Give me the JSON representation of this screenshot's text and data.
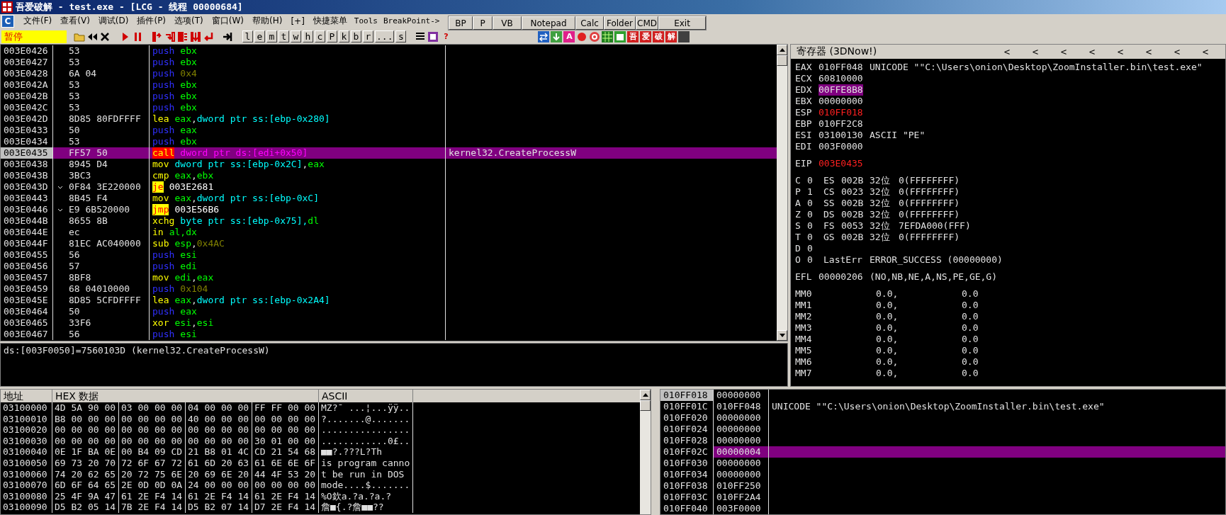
{
  "window": {
    "title": "吾爱破解 - test.exe - [LCG - 线程 00000684]"
  },
  "menu": {
    "system_button": "C",
    "items": [
      "文件(F)",
      "查看(V)",
      "调试(D)",
      "插件(P)",
      "选项(T)",
      "窗口(W)",
      "帮助(H)",
      "[+]",
      "快捷菜单",
      "Tools",
      "BreakPoint->"
    ]
  },
  "quick_buttons": [
    "BP",
    "P",
    "VB",
    "Notepad",
    "Calc",
    "Folder",
    "CMD",
    "Exit"
  ],
  "toolbar": {
    "status": "暂停",
    "letter_buttons": [
      "l",
      "e",
      "m",
      "t",
      "w",
      "h",
      "c",
      "P",
      "k",
      "b",
      "r",
      "...",
      "s"
    ],
    "help": "?",
    "badge_a": "A",
    "brand_badges": [
      "吾",
      "爱",
      "破",
      "解"
    ]
  },
  "disassembly": {
    "rows": [
      {
        "address": "003E0426",
        "hex": "53",
        "jump_from": false,
        "eip": false,
        "selected": false,
        "code": [
          {
            "kind": "push",
            "text": "push"
          },
          {
            "kind": "reg",
            "text": "ebx"
          }
        ]
      },
      {
        "address": "003E0427",
        "hex": "53",
        "jump_from": false,
        "eip": false,
        "selected": false,
        "code": [
          {
            "kind": "push",
            "text": "push"
          },
          {
            "kind": "reg",
            "text": "ebx"
          }
        ]
      },
      {
        "address": "003E0428",
        "hex": "6A 04",
        "jump_from": false,
        "eip": false,
        "selected": false,
        "code": [
          {
            "kind": "push",
            "text": "push"
          },
          {
            "kind": "imm",
            "text": "0x4"
          }
        ]
      },
      {
        "address": "003E042A",
        "hex": "53",
        "jump_from": false,
        "eip": false,
        "selected": false,
        "code": [
          {
            "kind": "push",
            "text": "push"
          },
          {
            "kind": "reg",
            "text": "ebx"
          }
        ]
      },
      {
        "address": "003E042B",
        "hex": "53",
        "jump_from": false,
        "eip": false,
        "selected": false,
        "code": [
          {
            "kind": "push",
            "text": "push"
          },
          {
            "kind": "reg",
            "text": "ebx"
          }
        ]
      },
      {
        "address": "003E042C",
        "hex": "53",
        "jump_from": false,
        "eip": false,
        "selected": false,
        "code": [
          {
            "kind": "push",
            "text": "push"
          },
          {
            "kind": "reg",
            "text": "ebx"
          }
        ]
      },
      {
        "address": "003E042D",
        "hex": "8D85 80FDFFFF",
        "jump_from": false,
        "eip": false,
        "selected": false,
        "code": [
          {
            "kind": "op",
            "text": "lea"
          },
          {
            "kind": "reg",
            "text": "eax"
          },
          {
            "kind": "sep",
            "text": ","
          },
          {
            "kind": "mem",
            "text": "dword ptr ss:[ebp-0x280]"
          }
        ]
      },
      {
        "address": "003E0433",
        "hex": "50",
        "jump_from": false,
        "eip": false,
        "selected": false,
        "code": [
          {
            "kind": "push",
            "text": "push"
          },
          {
            "kind": "reg",
            "text": "eax"
          }
        ]
      },
      {
        "address": "003E0434",
        "hex": "53",
        "jump_from": false,
        "eip": false,
        "selected": false,
        "code": [
          {
            "kind": "push",
            "text": "push"
          },
          {
            "kind": "reg",
            "text": "ebx"
          }
        ]
      },
      {
        "address": "003E0435",
        "hex": "FF57 50",
        "jump_from": false,
        "eip": true,
        "selected": true,
        "code": [
          {
            "kind": "call",
            "text": "call"
          },
          {
            "kind": "callarg",
            "text": "dword ptr ds:[edi+0x50]"
          }
        ],
        "comment": "kernel32.CreateProcessW"
      },
      {
        "address": "003E0438",
        "hex": "8945 D4",
        "jump_from": false,
        "eip": false,
        "selected": false,
        "code": [
          {
            "kind": "op",
            "text": "mov"
          },
          {
            "kind": "mem",
            "text": "dword ptr ss:[ebp-0x2C]"
          },
          {
            "kind": "sep",
            "text": ","
          },
          {
            "kind": "reg",
            "text": "eax"
          }
        ]
      },
      {
        "address": "003E043B",
        "hex": "3BC3",
        "jump_from": false,
        "eip": false,
        "selected": false,
        "code": [
          {
            "kind": "op",
            "text": "cmp"
          },
          {
            "kind": "reg",
            "text": "eax"
          },
          {
            "kind": "sep",
            "text": ","
          },
          {
            "kind": "reg",
            "text": "ebx"
          }
        ]
      },
      {
        "address": "003E043D",
        "hex": "0F84 3E220000",
        "jump_from": true,
        "eip": false,
        "selected": false,
        "code": [
          {
            "kind": "jump",
            "text": "je"
          },
          {
            "kind": "target",
            "text": "003E2681"
          }
        ]
      },
      {
        "address": "003E0443",
        "hex": "8B45 F4",
        "jump_from": false,
        "eip": false,
        "selected": false,
        "code": [
          {
            "kind": "op",
            "text": "mov"
          },
          {
            "kind": "reg",
            "text": "eax"
          },
          {
            "kind": "sep",
            "text": ","
          },
          {
            "kind": "mem",
            "text": "dword ptr ss:[ebp-0xC]"
          }
        ]
      },
      {
        "address": "003E0446",
        "hex": "E9 6B520000",
        "jump_from": true,
        "eip": false,
        "selected": false,
        "code": [
          {
            "kind": "jump",
            "text": "jmp"
          },
          {
            "kind": "target",
            "text": "003E56B6"
          }
        ]
      },
      {
        "address": "003E044B",
        "hex": "8655 8B",
        "jump_from": false,
        "eip": false,
        "selected": false,
        "code": [
          {
            "kind": "op",
            "text": "xchg"
          },
          {
            "kind": "mem",
            "text": "byte ptr ss:[ebp-0x75],"
          },
          {
            "kind": "reg",
            "text": "dl"
          }
        ]
      },
      {
        "address": "003E044E",
        "hex": "ec",
        "jump_from": false,
        "eip": false,
        "selected": false,
        "code": [
          {
            "kind": "op",
            "text": "in"
          },
          {
            "kind": "reg",
            "text": "al,dx"
          }
        ]
      },
      {
        "address": "003E044F",
        "hex": "81EC AC040000",
        "jump_from": false,
        "eip": false,
        "selected": false,
        "code": [
          {
            "kind": "op",
            "text": "sub"
          },
          {
            "kind": "reg",
            "text": "esp"
          },
          {
            "kind": "sep",
            "text": ","
          },
          {
            "kind": "imm",
            "text": "0x4AC"
          }
        ]
      },
      {
        "address": "003E0455",
        "hex": "56",
        "jump_from": false,
        "eip": false,
        "selected": false,
        "code": [
          {
            "kind": "push",
            "text": "push"
          },
          {
            "kind": "reg",
            "text": "esi"
          }
        ]
      },
      {
        "address": "003E0456",
        "hex": "57",
        "jump_from": false,
        "eip": false,
        "selected": false,
        "code": [
          {
            "kind": "push",
            "text": "push"
          },
          {
            "kind": "reg",
            "text": "edi"
          }
        ]
      },
      {
        "address": "003E0457",
        "hex": "8BF8",
        "jump_from": false,
        "eip": false,
        "selected": false,
        "code": [
          {
            "kind": "op",
            "text": "mov"
          },
          {
            "kind": "reg",
            "text": "edi"
          },
          {
            "kind": "sep",
            "text": ","
          },
          {
            "kind": "reg",
            "text": "eax"
          }
        ]
      },
      {
        "address": "003E0459",
        "hex": "68 04010000",
        "jump_from": false,
        "eip": false,
        "selected": false,
        "code": [
          {
            "kind": "push",
            "text": "push"
          },
          {
            "kind": "imm",
            "text": "0x104"
          }
        ]
      },
      {
        "address": "003E045E",
        "hex": "8D85 5CFDFFFF",
        "jump_from": false,
        "eip": false,
        "selected": false,
        "code": [
          {
            "kind": "op",
            "text": "lea"
          },
          {
            "kind": "reg",
            "text": "eax"
          },
          {
            "kind": "sep",
            "text": ","
          },
          {
            "kind": "mem",
            "text": "dword ptr ss:[ebp-0x2A4]"
          }
        ]
      },
      {
        "address": "003E0464",
        "hex": "50",
        "jump_from": false,
        "eip": false,
        "selected": false,
        "code": [
          {
            "kind": "push",
            "text": "push"
          },
          {
            "kind": "reg",
            "text": "eax"
          }
        ]
      },
      {
        "address": "003E0465",
        "hex": "33F6",
        "jump_from": false,
        "eip": false,
        "selected": false,
        "code": [
          {
            "kind": "op",
            "text": "xor"
          },
          {
            "kind": "reg",
            "text": "esi"
          },
          {
            "kind": "sep",
            "text": ","
          },
          {
            "kind": "reg",
            "text": "esi"
          }
        ]
      },
      {
        "address": "003E0467",
        "hex": "56",
        "jump_from": false,
        "eip": false,
        "selected": false,
        "code": [
          {
            "kind": "push",
            "text": "push"
          },
          {
            "kind": "reg",
            "text": "esi"
          }
        ]
      }
    ]
  },
  "info": "ds:[003F0050]=7560103D (kernel32.CreateProcessW)",
  "registers": {
    "title": "寄存器 (3DNow!)",
    "nav_arrows": [
      "<",
      "<",
      "<",
      "<",
      "<",
      "<",
      "<",
      "<"
    ],
    "general": [
      {
        "name": "EAX",
        "value": "010FF048",
        "changed": false,
        "selected": false,
        "comment": "UNICODE \"\"C:\\Users\\onion\\Desktop\\ZoomInstaller.bin\\test.exe\""
      },
      {
        "name": "ECX",
        "value": "60810000",
        "changed": false,
        "selected": false
      },
      {
        "name": "EDX",
        "value": "00FFE8B8",
        "changed": false,
        "selected": true
      },
      {
        "name": "EBX",
        "value": "00000000",
        "changed": false,
        "selected": false
      },
      {
        "name": "ESP",
        "value": "010FF018",
        "changed": true,
        "selected": false
      },
      {
        "name": "EBP",
        "value": "010FF2C8",
        "changed": false,
        "selected": false
      },
      {
        "name": "ESI",
        "value": "03100130",
        "changed": false,
        "selected": false,
        "comment": "ASCII \"PE\""
      },
      {
        "name": "EDI",
        "value": "003F0000",
        "changed": false,
        "selected": false
      }
    ],
    "eip": {
      "name": "EIP",
      "value": "003E0435",
      "changed": true,
      "selected": false
    },
    "flags": [
      {
        "flag": "C",
        "bit": "0",
        "seg": "ES",
        "selector": "002B",
        "width": "32位",
        "base": "0(FFFFFFFF)"
      },
      {
        "flag": "P",
        "bit": "1",
        "seg": "CS",
        "selector": "0023",
        "width": "32位",
        "base": "0(FFFFFFFF)"
      },
      {
        "flag": "A",
        "bit": "0",
        "seg": "SS",
        "selector": "002B",
        "width": "32位",
        "base": "0(FFFFFFFF)"
      },
      {
        "flag": "Z",
        "bit": "0",
        "seg": "DS",
        "selector": "002B",
        "width": "32位",
        "base": "0(FFFFFFFF)"
      },
      {
        "flag": "S",
        "bit": "0",
        "seg": "FS",
        "selector": "0053",
        "width": "32位",
        "base": "7EFDA000(FFF)"
      },
      {
        "flag": "T",
        "bit": "0",
        "seg": "GS",
        "selector": "002B",
        "width": "32位",
        "base": "0(FFFFFFFF)"
      },
      {
        "flag": "D",
        "bit": "0"
      },
      {
        "flag": "O",
        "bit": "0",
        "label": "LastErr",
        "text": "ERROR_SUCCESS (00000000)"
      }
    ],
    "efl": {
      "name": "EFL",
      "value": "00000206",
      "text": "(NO,NB,NE,A,NS,PE,GE,G)"
    },
    "mmx": [
      {
        "name": "MM0",
        "a": "0.0,",
        "b": "0.0"
      },
      {
        "name": "MM1",
        "a": "0.0,",
        "b": "0.0"
      },
      {
        "name": "MM2",
        "a": "0.0,",
        "b": "0.0"
      },
      {
        "name": "MM3",
        "a": "0.0,",
        "b": "0.0"
      },
      {
        "name": "MM4",
        "a": "0.0,",
        "b": "0.0"
      },
      {
        "name": "MM5",
        "a": "0.0,",
        "b": "0.0"
      },
      {
        "name": "MM6",
        "a": "0.0,",
        "b": "0.0"
      },
      {
        "name": "MM7",
        "a": "0.0,",
        "b": "0.0"
      }
    ]
  },
  "dump": {
    "columns": [
      "地址",
      "HEX 数据",
      "ASCII"
    ],
    "rows": [
      {
        "address": "03100000",
        "hex": [
          "4D 5A 90 00",
          "03 00 00 00",
          "04 00 00 00",
          "FF FF 00 00"
        ],
        "ascii": "MZ?¯ ...¦...ÿÿ.."
      },
      {
        "address": "03100010",
        "hex": [
          "B8 00 00 00",
          "00 00 00 00",
          "40 00 00 00",
          "00 00 00 00"
        ],
        "ascii": "?.......@......."
      },
      {
        "address": "03100020",
        "hex": [
          "00 00 00 00",
          "00 00 00 00",
          "00 00 00 00",
          "00 00 00 00"
        ],
        "ascii": "................"
      },
      {
        "address": "03100030",
        "hex": [
          "00 00 00 00",
          "00 00 00 00",
          "00 00 00 00",
          "30 01 00 00"
        ],
        "ascii": "............0£.."
      },
      {
        "address": "03100040",
        "hex": [
          "0E 1F BA 0E",
          "00 B4 09 CD",
          "21 B8 01 4C",
          "CD 21 54 68"
        ],
        "ascii": "■■?.???L?Th"
      },
      {
        "address": "03100050",
        "hex": [
          "69 73 20 70",
          "72 6F 67 72",
          "61 6D 20 63",
          "61 6E 6E 6F"
        ],
        "ascii": "is program canno"
      },
      {
        "address": "03100060",
        "hex": [
          "74 20 62 65",
          "20 72 75 6E",
          "20 69 6E 20",
          "44 4F 53 20"
        ],
        "ascii": "t be run in DOS"
      },
      {
        "address": "03100070",
        "hex": [
          "6D 6F 64 65",
          "2E 0D 0D 0A",
          "24 00 00 00",
          "00 00 00 00"
        ],
        "ascii": "mode....$......."
      },
      {
        "address": "03100080",
        "hex": [
          "25 4F 9A 47",
          "61 2E F4 14",
          "61 2E F4 14",
          "61 2E F4 14"
        ],
        "ascii": "%O欽a.?a.?a.?"
      },
      {
        "address": "03100090",
        "hex": [
          "D5 B2 05 14",
          "7B 2E F4 14",
          "D5 B2 07 14",
          "D7 2E F4 14"
        ],
        "ascii": "詹■{.?詹■■??"
      }
    ]
  },
  "stack": {
    "rows": [
      {
        "address": "010FF018",
        "value": "00000000",
        "esp": true,
        "selected": false
      },
      {
        "address": "010FF01C",
        "value": "010FF048",
        "esp": false,
        "selected": false,
        "comment": "UNICODE \"\"C:\\Users\\onion\\Desktop\\ZoomInstaller.bin\\test.exe\""
      },
      {
        "address": "010FF020",
        "value": "00000000",
        "esp": false,
        "selected": false
      },
      {
        "address": "010FF024",
        "value": "00000000",
        "esp": false,
        "selected": false
      },
      {
        "address": "010FF028",
        "value": "00000000",
        "esp": false,
        "selected": false
      },
      {
        "address": "010FF02C",
        "value": "00000004",
        "esp": false,
        "selected": true
      },
      {
        "address": "010FF030",
        "value": "00000000",
        "esp": false,
        "selected": false
      },
      {
        "address": "010FF034",
        "value": "00000000",
        "esp": false,
        "selected": false
      },
      {
        "address": "010FF038",
        "value": "010FF250",
        "esp": false,
        "selected": false
      },
      {
        "address": "010FF03C",
        "value": "010FF2A4",
        "esp": false,
        "selected": false
      },
      {
        "address": "010FF040",
        "value": "003F0000",
        "esp": false,
        "selected": false
      }
    ]
  }
}
